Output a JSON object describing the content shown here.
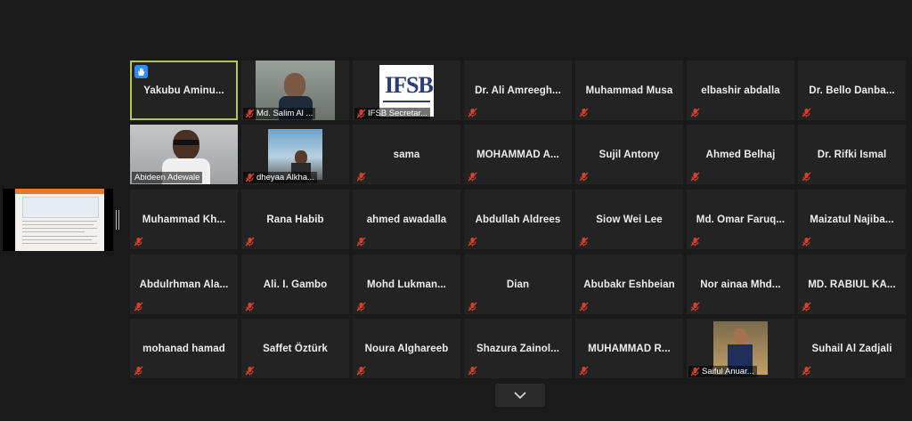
{
  "tiles": [
    {
      "name": "Yakubu  Aminu..."
    },
    {
      "name": "Md. Salim Al ..."
    },
    {
      "name": "IFSB Secretar..."
    },
    {
      "name": "Dr. Ali  Amreegh..."
    },
    {
      "name": "Muhammad Musa"
    },
    {
      "name": "elbashir abdalla"
    },
    {
      "name": "Dr. Bello  Danba..."
    },
    {
      "name": "Abideen Adewale"
    },
    {
      "name": "dheyaa Alkha..."
    },
    {
      "name": "sama"
    },
    {
      "name": "MOHAMMAD  A..."
    },
    {
      "name": "Sujil Antony"
    },
    {
      "name": "Ahmed Belhaj"
    },
    {
      "name": "Dr. Rifki Ismal"
    },
    {
      "name": "Muhammad  Kh..."
    },
    {
      "name": "Rana Habib"
    },
    {
      "name": "ahmed awadalla"
    },
    {
      "name": "Abdullah Aldrees"
    },
    {
      "name": "Siow Wei Lee"
    },
    {
      "name": "Md. Omar  Faruq..."
    },
    {
      "name": "Maizatul  Najiba..."
    },
    {
      "name": "Abdulrhman  Ala..."
    },
    {
      "name": "Ali. I. Gambo"
    },
    {
      "name": "Mohd  Lukman..."
    },
    {
      "name": "Dian"
    },
    {
      "name": "Abubakr Eshbeian"
    },
    {
      "name": "Nor ainaa  Mhd..."
    },
    {
      "name": "MD. RABIUL  KA..."
    },
    {
      "name": "mohanad hamad"
    },
    {
      "name": "Saffet Öztürk"
    },
    {
      "name": "Noura Alghareeb"
    },
    {
      "name": "Shazura  Zainol..."
    },
    {
      "name": "MUHAMMAD  R..."
    },
    {
      "name": "Saiful Anuar..."
    },
    {
      "name": "Suhail Al Zadjali"
    }
  ],
  "icons": {
    "muted": "muted-mic-icon",
    "hand": "raised-hand-icon",
    "chevron": "chevron-down-icon",
    "logo": "ifsb-logo"
  },
  "colors": {
    "active_speaker": "#b6c84a",
    "muted": "#d9402b",
    "hand": "#2d8cff",
    "tile": "#232323",
    "background": "#1a1a1a"
  }
}
